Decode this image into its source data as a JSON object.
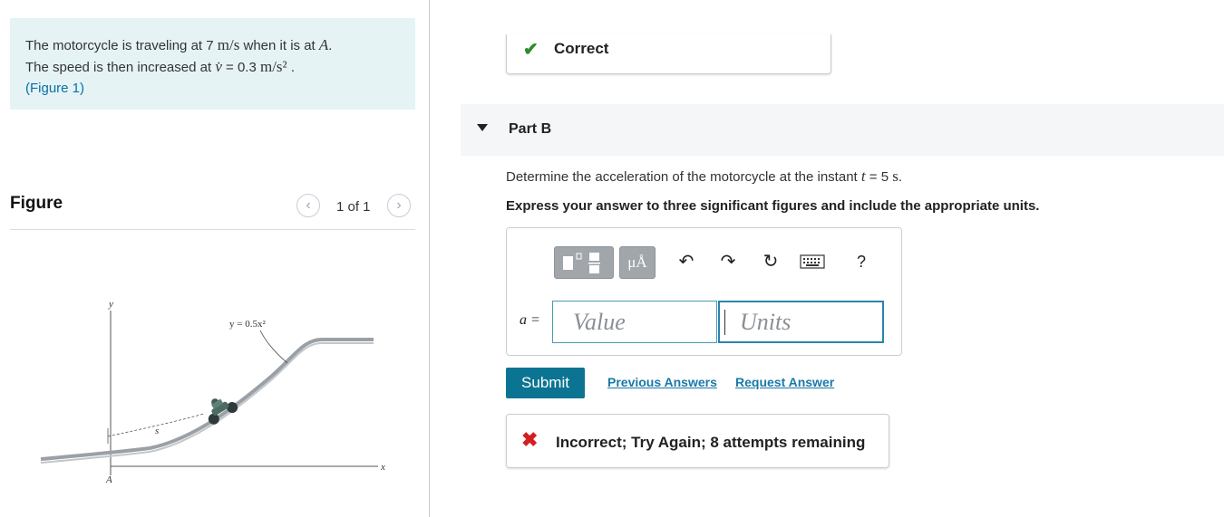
{
  "problem": {
    "line1_pre": "The motorcycle is traveling at 7",
    "line1_unit": "m/s",
    "line1_mid": "when it is at",
    "line1_var": "A",
    "line1_end": ".",
    "line2_pre": "The speed is then increased at",
    "line2_var": "v̇",
    "line2_mid": "= 0.3",
    "line2_unit": "m/s²",
    "line2_end": ".",
    "figure_link": "(Figure 1)"
  },
  "figure": {
    "title": "Figure",
    "pager": "1 of 1",
    "prev_icon": "chevron-left-icon",
    "next_icon": "chevron-right-icon",
    "curve_label": "y = 0.5x²",
    "axis_y": "y",
    "axis_x": "x",
    "point_label": "A",
    "arc_label": "s"
  },
  "status": {
    "correct_icon": "check-icon",
    "correct_text": "Correct"
  },
  "part_b": {
    "label": "Part B",
    "question_pre": "Determine the acceleration of the motorcycle at the instant",
    "question_var": "t",
    "question_mid": "= 5",
    "question_unit": "s",
    "question_end": ".",
    "instructions": "Express your answer to three significant figures and include the appropriate units."
  },
  "answer": {
    "toolbar": {
      "units_label": "μÅ",
      "help_label": "?",
      "icons": [
        "templates-icon",
        "units-icon",
        "undo-icon",
        "redo-icon",
        "reset-icon",
        "keyboard-icon",
        "help-icon"
      ]
    },
    "var_label": "a =",
    "value_placeholder": "Value",
    "units_placeholder": "Units"
  },
  "actions": {
    "submit": "Submit",
    "previous_answers": "Previous Answers",
    "request_answer": "Request Answer"
  },
  "feedback": {
    "icon": "x-icon",
    "text": "Incorrect; Try Again; 8 attempts remaining"
  },
  "colors": {
    "problem_bg": "#e5f3f5",
    "submit_bg": "#0c7493",
    "link": "#1a79a8",
    "correct": "#2e8b2e",
    "incorrect": "#d21f1f"
  }
}
